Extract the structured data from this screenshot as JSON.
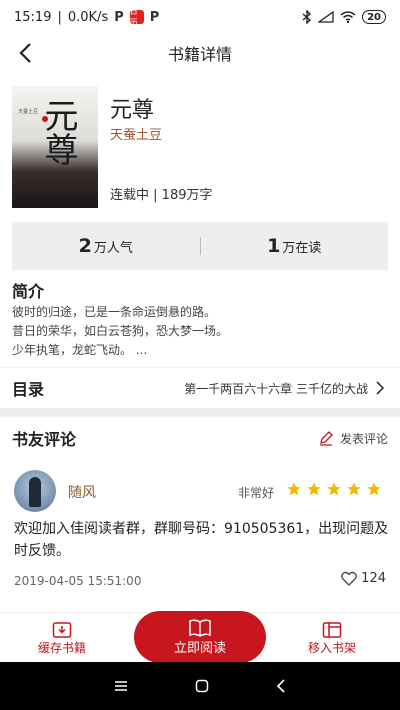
{
  "status_bar": {
    "time": "15:19",
    "speed": "0.0K/s",
    "app_badge": "日历",
    "p_icon": "P",
    "battery": "20"
  },
  "header": {
    "title": "书籍详情"
  },
  "book": {
    "cover_title": "元尊",
    "cover_sub": "天蚕土豆",
    "title": "元尊",
    "author": "天蚕土豆",
    "status": "连载中",
    "separator": " | ",
    "word_count": "189万字"
  },
  "stats": {
    "popularity_value": "2",
    "popularity_unit": "万人气",
    "reading_value": "1",
    "reading_unit": "万在读"
  },
  "intro": {
    "heading": "简介",
    "lines": [
      "彼时的归途，已是一条命运倒悬的路。",
      "昔日的荣华，如白云苍狗，恐大梦一场。",
      "少年执笔，龙蛇飞动。 ..."
    ]
  },
  "toc": {
    "label": "目录",
    "latest_chapter": "第一千两百六十六章 三千亿的大战"
  },
  "reviews": {
    "heading": "书友评论",
    "write_label": "发表评论",
    "items": [
      {
        "name": "随风",
        "rating_label": "非常好",
        "stars": 5,
        "text": "欢迎加入佳阅读者群，群聊号码：910505361，出现问题及时反馈。",
        "date": "2019-04-05 15:51:00",
        "likes": "124"
      }
    ]
  },
  "bottom": {
    "cache_label": "缓存书籍",
    "read_label": "立即阅读",
    "shelf_label": "移入书架"
  },
  "colors": {
    "accent": "#c7161e",
    "star": "#f5b800",
    "author": "#a0522d"
  }
}
